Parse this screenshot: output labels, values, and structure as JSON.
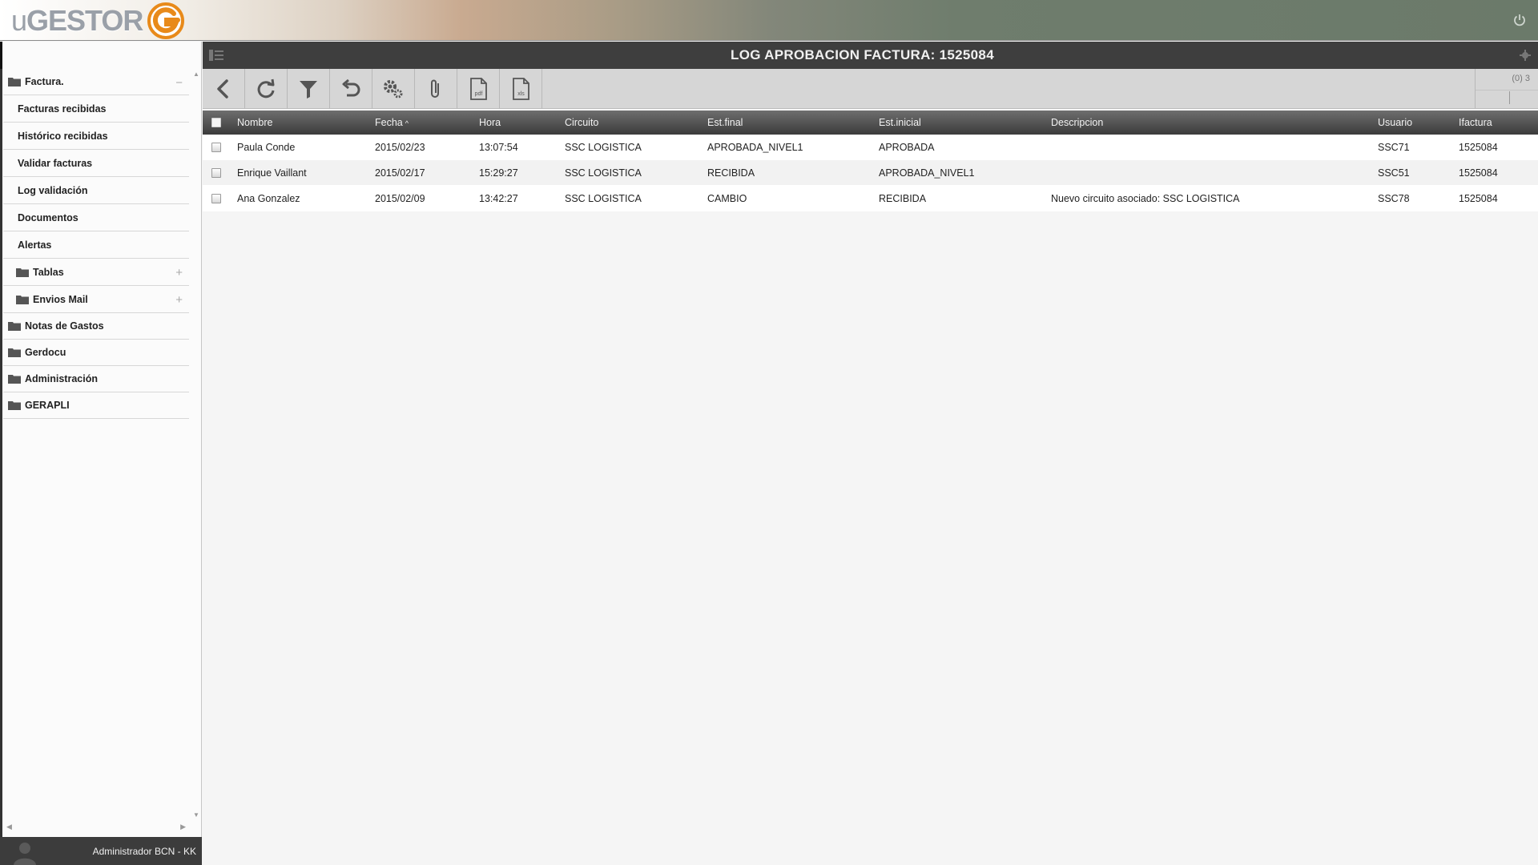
{
  "app": {
    "logo_prefix": "u",
    "logo_main": "GESTOR"
  },
  "sidebar": {
    "items": [
      {
        "label": "Factura.",
        "level": 0,
        "toggle": "−"
      },
      {
        "label": "Facturas recibidas",
        "level": 1
      },
      {
        "label": "Histórico recibidas",
        "level": 1
      },
      {
        "label": "Validar facturas",
        "level": 1
      },
      {
        "label": "Log validación",
        "level": 1
      },
      {
        "label": "Documentos",
        "level": 1
      },
      {
        "label": "Alertas",
        "level": 1
      },
      {
        "label": "Tablas",
        "level": 1,
        "folder": true,
        "toggle": "+"
      },
      {
        "label": "Envios Mail",
        "level": 1,
        "folder": true,
        "toggle": "+"
      },
      {
        "label": "Notas de Gastos",
        "level": 0
      },
      {
        "label": "Gerdocu",
        "level": 0
      },
      {
        "label": "Administración",
        "level": 0
      },
      {
        "label": "GERAPLI",
        "level": 0
      }
    ]
  },
  "user": {
    "name": "Administrador BCN - KK"
  },
  "main": {
    "title": "LOG APROBACION FACTURA: 1525084",
    "pager": "(0) 3",
    "toolbar": [
      {
        "name": "back",
        "icon": "chevron-left-icon"
      },
      {
        "name": "refresh",
        "icon": "refresh-icon"
      },
      {
        "name": "filter",
        "icon": "filter-icon"
      },
      {
        "name": "undo",
        "icon": "undo-icon"
      },
      {
        "name": "settings",
        "icon": "gears-icon"
      },
      {
        "name": "attach",
        "icon": "paperclip-icon"
      },
      {
        "name": "export-pdf",
        "icon": "pdf-file-icon",
        "text": "pdf"
      },
      {
        "name": "export-xls",
        "icon": "xls-file-icon",
        "text": "xls"
      }
    ]
  },
  "grid": {
    "columns": [
      "Nombre",
      "Fecha",
      "Hora",
      "Circuito",
      "Est.final",
      "Est.inicial",
      "Descripcion",
      "Usuario",
      "Ifactura"
    ],
    "sort_indicator": "^",
    "rows": [
      [
        "Paula Conde",
        "2015/02/23",
        "13:07:54",
        "SSC LOGISTICA",
        "APROBADA_NIVEL1",
        "APROBADA",
        "",
        "SSC71",
        "1525084"
      ],
      [
        "Enrique Vaillant",
        "2015/02/17",
        "15:29:27",
        "SSC LOGISTICA",
        "RECIBIDA",
        "APROBADA_NIVEL1",
        "",
        "SSC51",
        "1525084"
      ],
      [
        "Ana Gonzalez",
        "2015/02/09",
        "13:42:27",
        "SSC LOGISTICA",
        "CAMBIO",
        "RECIBIDA",
        "Nuevo circuito asociado: SSC LOGISTICA",
        "SSC78",
        "1525084"
      ]
    ]
  },
  "colors": {
    "accent": "#e88a1a",
    "title_bar": "#3e3e3e",
    "toolbar": "#d6d6d6"
  }
}
